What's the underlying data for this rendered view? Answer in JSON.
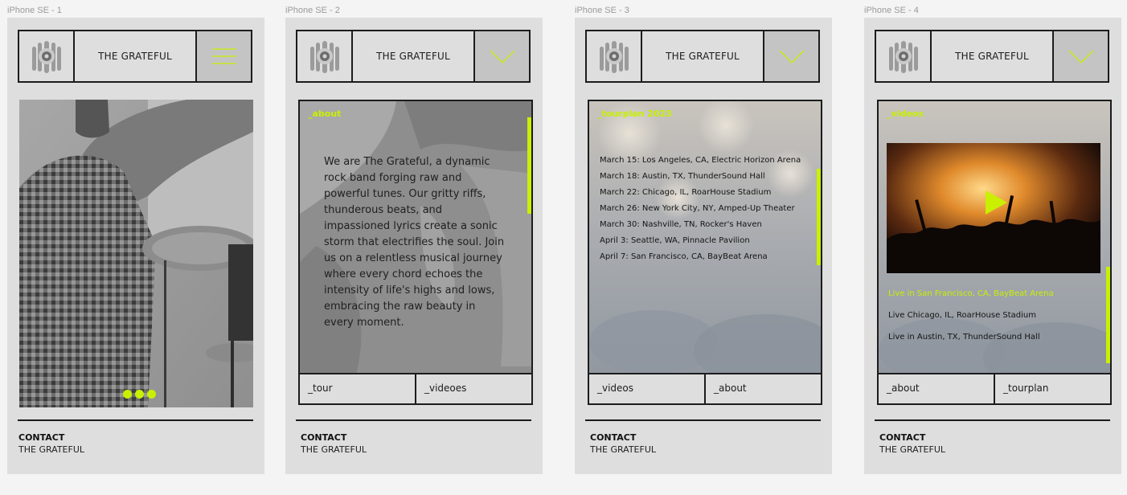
{
  "frames": [
    {
      "label": "iPhone SE - 1"
    },
    {
      "label": "iPhone SE - 2"
    },
    {
      "label": "iPhone SE - 3"
    },
    {
      "label": "iPhone SE - 4"
    }
  ],
  "header": {
    "title": "THE GRATEFUL"
  },
  "about": {
    "title": "_about",
    "body": "We are The Grateful, a dynamic rock band forging raw and powerful tunes. Our gritty riffs, thunderous beats, and impassioned lyrics create a sonic storm that electrifies the soul. Join us on a relentless musical journey where every chord echoes the intensity of life's highs and lows, embracing the raw beauty in every moment."
  },
  "tour": {
    "title": "_tourplan 2023",
    "dates": [
      "March 15: Los Angeles, CA, Electric Horizon Arena",
      "March 18: Austin, TX, ThunderSound Hall",
      "March 22: Chicago, IL, RoarHouse Stadium",
      "March 26: New York City, NY, Amped-Up Theater",
      "March 30: Nashville, TN, Rocker's Haven",
      "April 3: Seattle, WA, Pinnacle Pavilion",
      "April 7: San Francisco, CA, BayBeat Arena"
    ]
  },
  "videos": {
    "title": "_videos",
    "items": [
      "Live in San Francisco, CA, BayBeat Arena",
      "Live Chicago, IL, RoarHouse Stadium",
      "Live in Austin, TX, ThunderSound Hall"
    ]
  },
  "nav": {
    "frame2": [
      "_tour",
      "_videoes"
    ],
    "frame3": [
      "_videos",
      "_about"
    ],
    "frame4": [
      "_about",
      "_tourplan"
    ]
  },
  "contact": {
    "heading": "CONTACT",
    "name": "THE GRATEFUL"
  },
  "colors": {
    "accent": "#c8f000",
    "frame": "#dedede",
    "border": "#1c1c1c",
    "menu_bg": "#c4c4c4"
  },
  "icons": {
    "logo": "band-logo-icon",
    "menu": "hamburger-menu-icon",
    "collapse": "chevron-down-icon",
    "play": "play-icon"
  }
}
